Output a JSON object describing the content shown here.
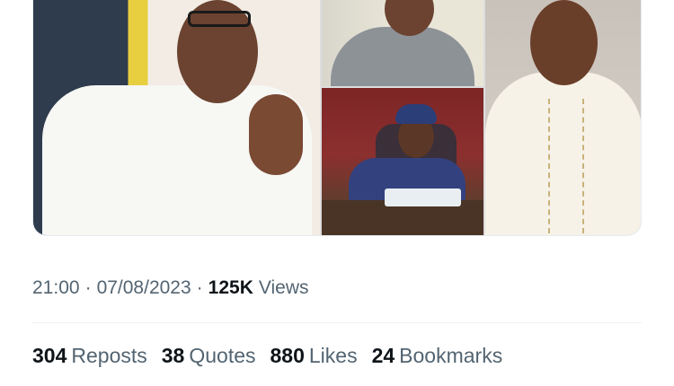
{
  "tweet": {
    "media": {
      "images": [
        {
          "subject": "man in white robe praying hands"
        },
        {
          "subject": "man in grey outfit"
        },
        {
          "subject": "woman at desk with documents"
        },
        {
          "subject": "man in embroidered white outfit"
        }
      ]
    },
    "meta": {
      "time": "21:00",
      "separator": "·",
      "date": "07/08/2023",
      "views_count": "125K",
      "views_label": "Views"
    },
    "stats": {
      "reposts_count": "304",
      "reposts_label": "Reposts",
      "quotes_count": "38",
      "quotes_label": "Quotes",
      "likes_count": "880",
      "likes_label": "Likes",
      "bookmarks_count": "24",
      "bookmarks_label": "Bookmarks"
    }
  }
}
